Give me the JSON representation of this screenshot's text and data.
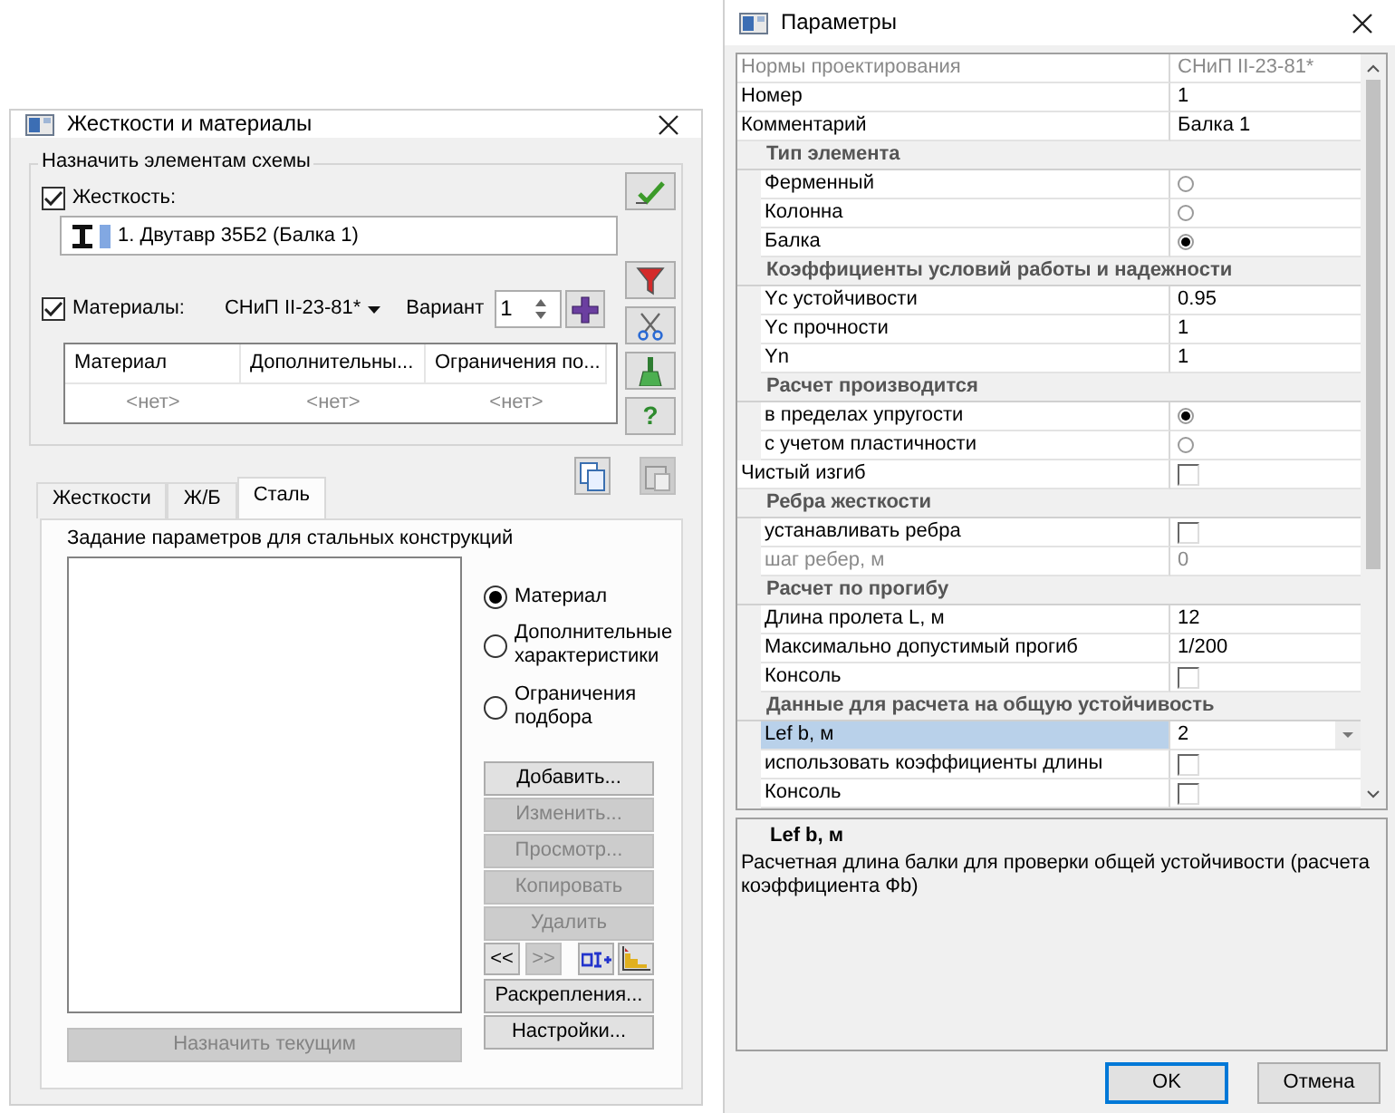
{
  "left_dialog": {
    "title": "Жесткости и материалы",
    "group_label": "Назначить элементам схемы",
    "stiffness": {
      "label": "Жесткость:",
      "checked": true,
      "value": "1. Двутавр 35Б2 (Балка 1)"
    },
    "materials": {
      "label": "Материалы:",
      "checked": true,
      "norm": "СНиП II-23-81*",
      "variant_label": "Вариант",
      "variant": "1"
    },
    "table": {
      "columns": [
        "Материал",
        "Дополнительны...",
        "Ограничения по..."
      ],
      "rows": [
        [
          "<нет>",
          "<нет>",
          "<нет>"
        ]
      ]
    },
    "help_label": "?",
    "tabs": [
      {
        "label": "Жесткости",
        "selected": false
      },
      {
        "label": "Ж/Б",
        "selected": false
      },
      {
        "label": "Сталь",
        "selected": true
      }
    ],
    "panel_caption": "Задание параметров для стальных конструкций",
    "options": [
      {
        "label": "Материал",
        "selected": true
      },
      {
        "label": "Дополнительные характеристики",
        "selected": false
      },
      {
        "label": "Ограничения подбора",
        "selected": false
      }
    ],
    "actions": [
      {
        "label": "Добавить...",
        "disabled": false
      },
      {
        "label": "Изменить...",
        "disabled": true
      },
      {
        "label": "Просмотр...",
        "disabled": true
      },
      {
        "label": "Копировать",
        "disabled": true
      },
      {
        "label": "Удалить",
        "disabled": true
      }
    ],
    "nav": [
      {
        "label": "<<",
        "disabled": false
      },
      {
        "label": ">>",
        "disabled": true
      }
    ],
    "bottom_actions": [
      {
        "label": "Раскрепления...",
        "disabled": false
      },
      {
        "label": "Настройки...",
        "disabled": false
      }
    ],
    "assign_button": {
      "label": "Назначить текущим",
      "disabled": true
    }
  },
  "right_dialog": {
    "title": "Параметры",
    "grid": [
      {
        "kind": "text",
        "label": "Нормы проектирования",
        "value": "СНиП II-23-81*",
        "disabled": true,
        "selected": false
      },
      {
        "kind": "text",
        "label": "Номер",
        "value": "1",
        "disabled": false,
        "selected": false
      },
      {
        "kind": "text",
        "label": "Комментарий",
        "value": "Балка 1",
        "disabled": false,
        "selected": false
      },
      {
        "kind": "category",
        "label": "Тип элемента",
        "children": [
          {
            "kind": "radio",
            "label": "Ферменный",
            "checked": false,
            "disabled": false,
            "selected": false
          },
          {
            "kind": "radio",
            "label": "Колонна",
            "checked": false,
            "disabled": false,
            "selected": false
          },
          {
            "kind": "radio",
            "label": "Балка",
            "checked": true,
            "disabled": false,
            "selected": false
          }
        ]
      },
      {
        "kind": "category",
        "label": "Коэффициенты условий работы и надежности",
        "children": [
          {
            "kind": "text",
            "label": "Yc устойчивости",
            "value": "0.95",
            "disabled": false,
            "selected": false
          },
          {
            "kind": "text",
            "label": "Yc прочности",
            "value": "1",
            "disabled": false,
            "selected": false
          },
          {
            "kind": "text",
            "label": "Yn",
            "value": "1",
            "disabled": false,
            "selected": false
          }
        ]
      },
      {
        "kind": "category",
        "label": "Расчет производится",
        "children": [
          {
            "kind": "radio",
            "label": "в пределах упругости",
            "checked": true,
            "disabled": false,
            "selected": false
          },
          {
            "kind": "radio",
            "label": "с учетом пластичности",
            "checked": false,
            "disabled": false,
            "selected": false
          }
        ]
      },
      {
        "kind": "checkbox",
        "label": "Чистый изгиб",
        "checked": false,
        "disabled": false,
        "selected": false
      },
      {
        "kind": "category",
        "label": "Ребра жесткости",
        "children": [
          {
            "kind": "checkbox",
            "label": "устанавливать ребра",
            "checked": false,
            "disabled": false,
            "selected": false
          },
          {
            "kind": "text",
            "label": "шаг ребер, м",
            "value": "0",
            "disabled": true,
            "selected": false
          }
        ]
      },
      {
        "kind": "category",
        "label": "Расчет по прогибу",
        "children": [
          {
            "kind": "text",
            "label": "Длина пролета L, м",
            "value": "12",
            "disabled": false,
            "selected": false
          },
          {
            "kind": "text",
            "label": "Максимально допустимый прогиб",
            "value": "1/200",
            "disabled": false,
            "selected": false
          },
          {
            "kind": "checkbox",
            "label": "Консоль",
            "checked": false,
            "disabled": false,
            "selected": false
          }
        ]
      },
      {
        "kind": "category",
        "label": "Данные для расчета на общую устойчивость",
        "children": [
          {
            "kind": "dropdown",
            "label": "Lef b, м",
            "value": "2",
            "disabled": false,
            "selected": true
          },
          {
            "kind": "checkbox",
            "label": "использовать коэффициенты длины",
            "checked": false,
            "disabled": false,
            "selected": false
          },
          {
            "kind": "checkbox",
            "label": "Консоль",
            "checked": false,
            "disabled": false,
            "selected": false
          }
        ]
      }
    ],
    "description": {
      "title": "Lef b, м",
      "text": "Расчетная длина балки для проверки общей устойчивости (расчета коэффициента Фb)"
    },
    "buttons": [
      {
        "label": "OK",
        "default": true
      },
      {
        "label": "Отмена",
        "default": false
      }
    ]
  }
}
